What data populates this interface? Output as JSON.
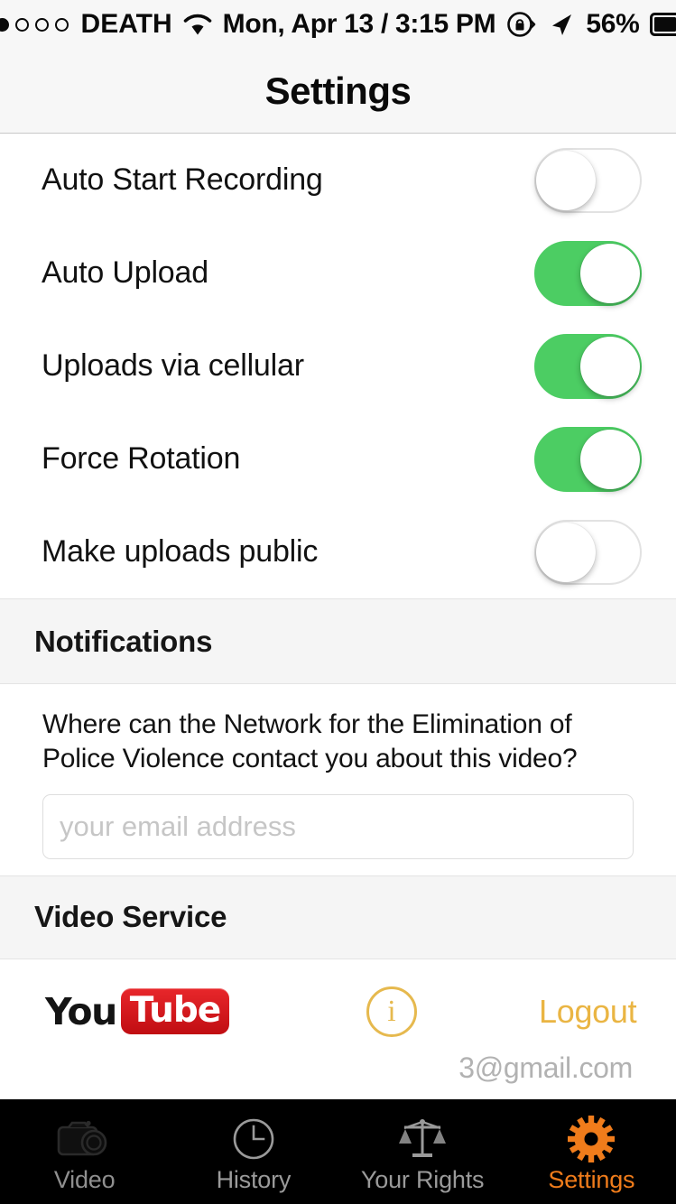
{
  "status_bar": {
    "signal_dots_filled": 2,
    "signal_dots_total": 5,
    "carrier": "DEATH",
    "wifi_icon": "wifi-icon",
    "datetime": "Mon, Apr 13 / 3:15 PM",
    "rotation_lock_icon": "rotation-lock-icon",
    "location_icon": "location-arrow-icon",
    "battery_percent": "56%",
    "battery_level": 56,
    "battery_icon": "battery-icon"
  },
  "nav": {
    "title": "Settings"
  },
  "settings": {
    "toggles": [
      {
        "label": "Auto Start Recording",
        "on": false
      },
      {
        "label": "Auto Upload",
        "on": true
      },
      {
        "label": "Uploads via cellular",
        "on": true
      },
      {
        "label": "Force Rotation",
        "on": true
      },
      {
        "label": "Make uploads public",
        "on": false
      }
    ]
  },
  "notifications": {
    "header": "Notifications",
    "question": "Where can the Network for the Elimination of Police Violence contact you about this video?",
    "email_value": "",
    "email_placeholder": "your email address"
  },
  "video_service": {
    "header": "Video Service",
    "provider_logo": "youtube-logo",
    "provider_name_part1": "You",
    "provider_name_part2": "Tube",
    "info_icon": "info-icon",
    "info_glyph": "i",
    "logout_label": "Logout",
    "account_email": "3@gmail.com"
  },
  "tab_bar": {
    "tabs": [
      {
        "label": "Video",
        "icon": "camera-icon",
        "active": false,
        "dim": true
      },
      {
        "label": "History",
        "icon": "clock-icon",
        "active": false,
        "dim": false
      },
      {
        "label": "Your Rights",
        "icon": "scales-of-justice-icon",
        "active": false,
        "dim": false
      },
      {
        "label": "Settings",
        "icon": "gear-icon",
        "active": true,
        "dim": false
      }
    ]
  },
  "colors": {
    "toggle_on": "#4ccd63",
    "accent_gold": "#eab543",
    "tab_active": "#f07c1b",
    "youtube_red": "#d81317",
    "section_bg": "#f5f5f5"
  }
}
